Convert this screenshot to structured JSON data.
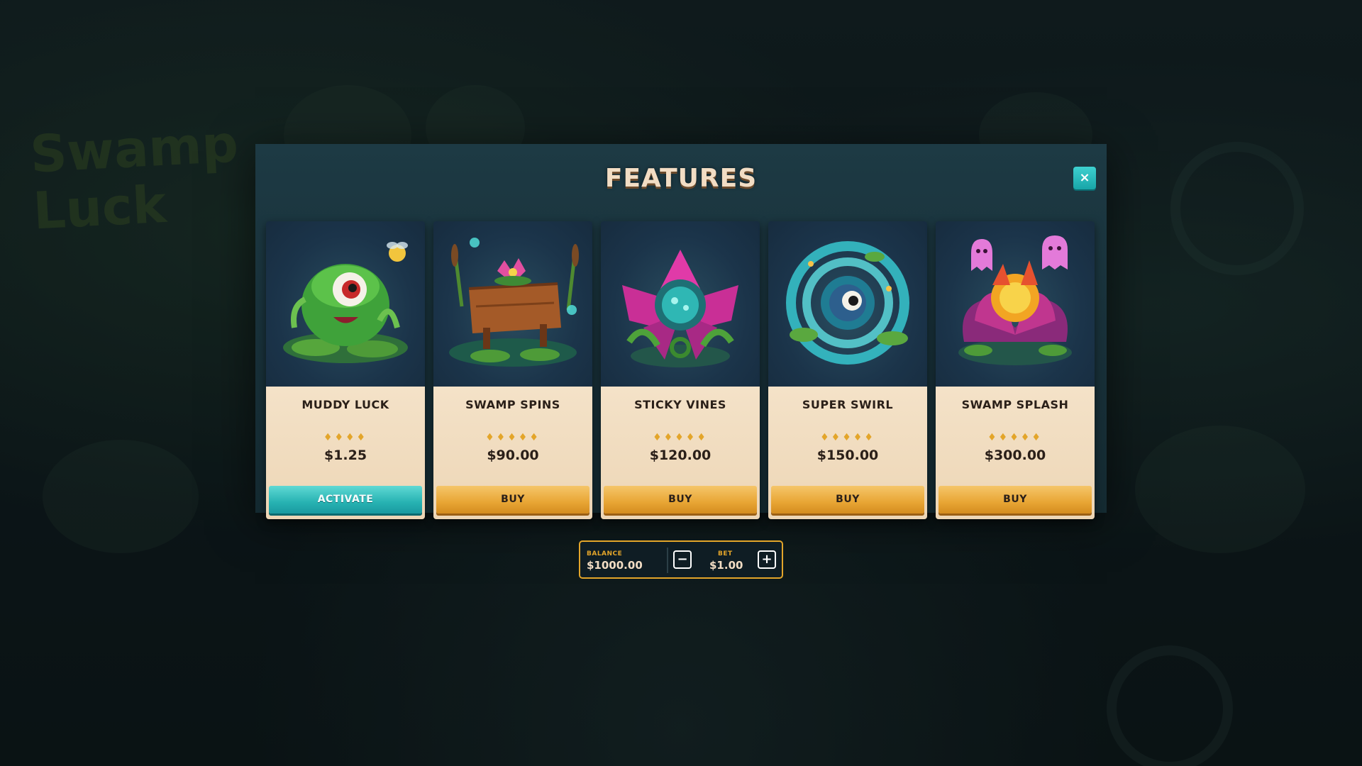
{
  "background": {
    "logo_text": "Swamp Luck"
  },
  "modal": {
    "title": "FEATURES",
    "close_label": "×"
  },
  "cards": [
    {
      "name": "MUDDY LUCK",
      "rating": "♦♦♦♦",
      "price": "$1.25",
      "button": "ACTIVATE",
      "button_style": "activate",
      "art": "green-swamp-monster-icon"
    },
    {
      "name": "SWAMP SPINS",
      "rating": "♦♦♦♦♦",
      "price": "$90.00",
      "button": "BUY",
      "button_style": "buy",
      "art": "wooden-sign-lotus-icon"
    },
    {
      "name": "STICKY VINES",
      "rating": "♦♦♦♦♦",
      "price": "$120.00",
      "button": "BUY",
      "button_style": "buy",
      "art": "pink-carnivorous-flower-icon"
    },
    {
      "name": "SUPER SWIRL",
      "rating": "♦♦♦♦♦",
      "price": "$150.00",
      "button": "BUY",
      "button_style": "buy",
      "art": "water-vortex-eye-icon"
    },
    {
      "name": "SWAMP SPLASH",
      "rating": "♦♦♦♦♦",
      "price": "$300.00",
      "button": "BUY",
      "button_style": "buy",
      "art": "magic-bloom-ghosts-icon"
    }
  ],
  "hud": {
    "balance_label": "BALANCE",
    "balance_value": "$1000.00",
    "bet_label": "BET",
    "bet_value": "$1.00",
    "minus_label": "−",
    "plus_label": "+"
  },
  "colors": {
    "accent_gold": "#e3a52a",
    "accent_teal": "#27b2b2",
    "card_cream": "#f4e2c8",
    "modal_bg": "#1d3a44"
  }
}
